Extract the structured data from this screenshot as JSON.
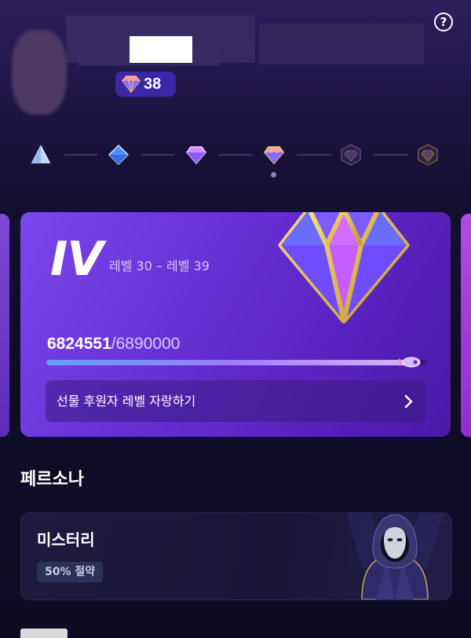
{
  "header": {
    "help_icon": "question-circle-icon",
    "help_glyph": "?",
    "badge": {
      "icon": "gem-badge-icon",
      "count": "38"
    }
  },
  "tiers": [
    {
      "name": "tier-1-icon",
      "state": "achieved",
      "color": "#a8c8ff"
    },
    {
      "name": "tier-2-icon",
      "state": "achieved",
      "color": "#6aa8ff"
    },
    {
      "name": "tier-3-icon",
      "state": "achieved",
      "color": "#c77dff"
    },
    {
      "name": "tier-4-icon",
      "state": "current",
      "color": "#ff8fd0"
    },
    {
      "name": "tier-5-icon",
      "state": "locked",
      "color": "#5a4a7a"
    },
    {
      "name": "tier-6-icon",
      "state": "locked",
      "color": "#7a5a3a"
    }
  ],
  "level_card": {
    "roman": "IV",
    "range": "레벨 30 – 레벨 39",
    "points_current": "6824551",
    "points_total": "/6890000",
    "progress": 0.9905,
    "gift_label": "선물 후원자 레벨 자랑하기",
    "gem_icon": "large-diamond-icon",
    "chevron_icon": "chevron-right-icon"
  },
  "persona": {
    "section_title": "페르소나",
    "title": "미스터리",
    "discount": "50% 절약",
    "art_icon": "hooded-mask-figure-icon"
  },
  "colors": {
    "accent": "#6a33d8",
    "gold": "#e8c45a",
    "badge_bg": "#3b26a8"
  }
}
